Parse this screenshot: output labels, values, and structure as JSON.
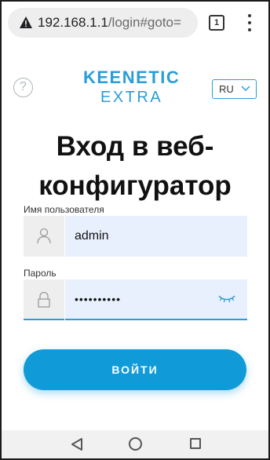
{
  "browser": {
    "url_host": "192.168.1.1",
    "url_path": "/login#goto=",
    "tab_count": "1"
  },
  "header": {
    "help_symbol": "?",
    "logo_line1": "KEENETIC",
    "logo_line2": "EXTRA",
    "language": "RU"
  },
  "page": {
    "title": "Вход в веб-конфигуратор"
  },
  "form": {
    "username_label": "Имя пользователя",
    "username_value": "admin",
    "password_label": "Пароль",
    "password_value": "••••••••••",
    "submit_label": "ВОЙТИ"
  },
  "colors": {
    "accent": "#119ad8",
    "input_bg": "#e8f0fe"
  }
}
